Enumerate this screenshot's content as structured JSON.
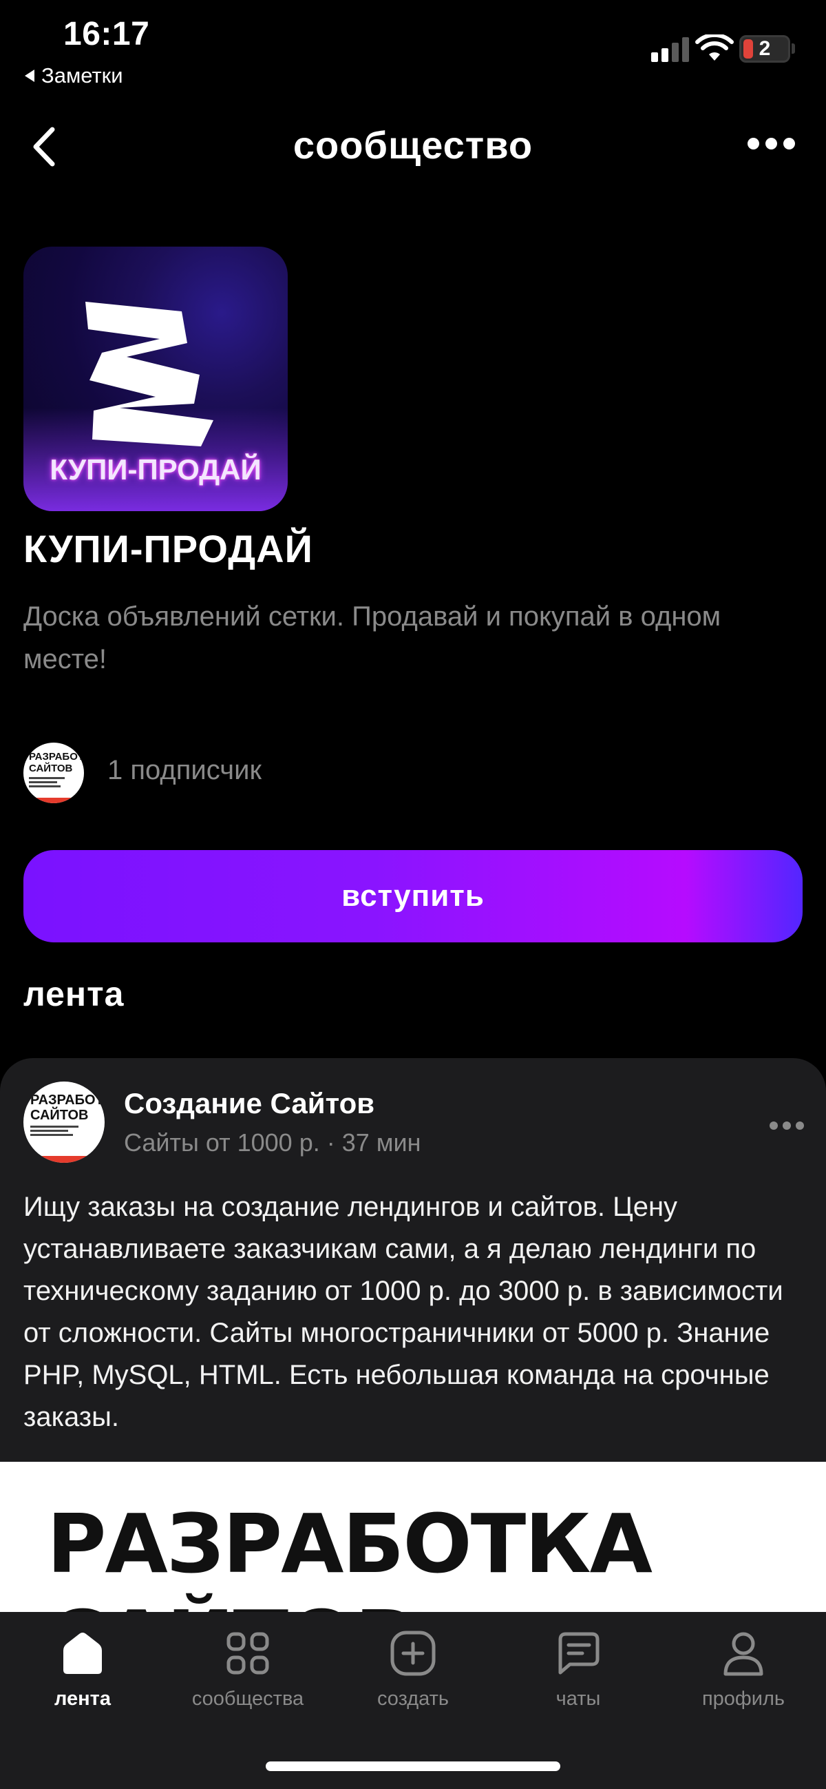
{
  "status_bar": {
    "time": "16:17",
    "back_app": "Заметки",
    "battery_level": "2"
  },
  "nav": {
    "title": "сообщество"
  },
  "community": {
    "logo_text": "КУПИ-ПРОДАЙ",
    "name": "КУПИ-ПРОДАЙ",
    "description": "Доска объявлений сетки. Продавай и покупай в одном месте!",
    "subscribers": "1 подписчик",
    "join_label": "вступить",
    "accent_colors": [
      "#7a12ff",
      "#b60bff",
      "#5326ff"
    ]
  },
  "feed": {
    "heading": "лента",
    "posts": [
      {
        "author": "Создание Сайтов",
        "meta": "Сайты от 1000 р. · 37 мин",
        "avatar_text": "РАЗРАБОТКА САЙТОВ",
        "text": "Ищу заказы на создание лендингов и сайтов. Цену устанавливаете заказчикам сами, а я делаю лендинги по техническому заданию от 1000 р. до 3000 р. в зависимости от сложности. Сайты многостраничники от 5000 р. Знание PHP, MySQL, HTML. Есть небольшая команда на срочные заказы.",
        "image_line1": "РАЗРАБОТКА",
        "image_line2": "САЙТОВ"
      }
    ]
  },
  "tabbar": {
    "items": [
      {
        "label": "лента",
        "icon": "home-icon",
        "active": true
      },
      {
        "label": "сообщества",
        "icon": "grid-icon",
        "active": false
      },
      {
        "label": "создать",
        "icon": "plus-square-icon",
        "active": false
      },
      {
        "label": "чаты",
        "icon": "chat-icon",
        "active": false
      },
      {
        "label": "профиль",
        "icon": "person-icon",
        "active": false
      }
    ]
  }
}
